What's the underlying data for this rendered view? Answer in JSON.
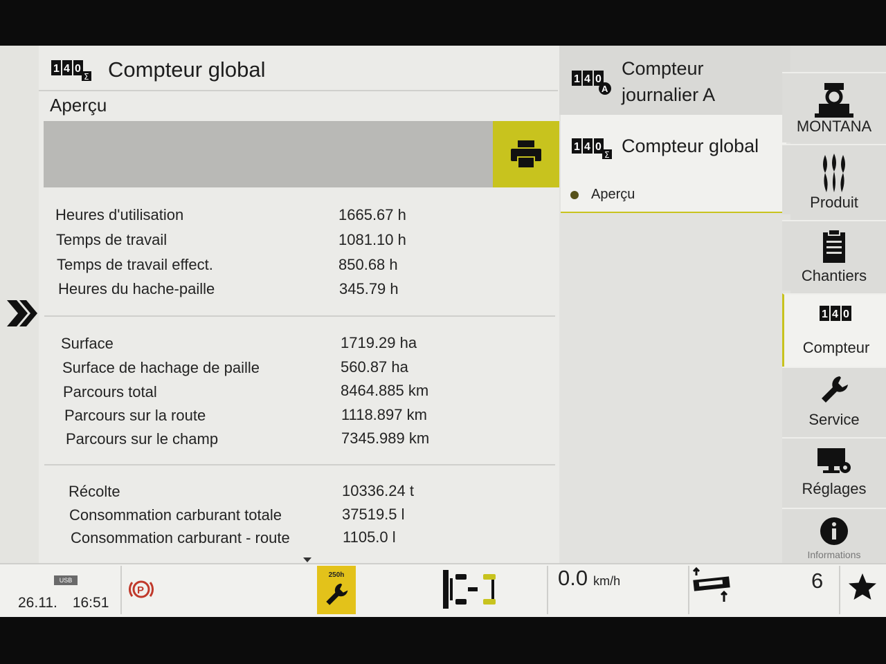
{
  "main": {
    "title": "Compteur global",
    "subtitle": "Aperçu",
    "groups": [
      {
        "rows": [
          {
            "label": "Heures d'utilisation",
            "value": "1665.67 h"
          },
          {
            "label": "Temps de travail",
            "value": "1081.10 h"
          },
          {
            "label": "Temps de travail effect.",
            "value": "850.68 h"
          },
          {
            "label": "Heures du hache-paille",
            "value": "345.79 h"
          }
        ]
      },
      {
        "rows": [
          {
            "label": "Surface",
            "value": "1719.29 ha"
          },
          {
            "label": "Surface de hachage de paille",
            "value": "560.87 ha"
          },
          {
            "label": "Parcours total",
            "value": "8464.885 km"
          },
          {
            "label": "Parcours sur la route",
            "value": "1118.897 km"
          },
          {
            "label": "Parcours sur le champ",
            "value": "7345.989 km"
          }
        ]
      },
      {
        "rows": [
          {
            "label": "Récolte",
            "value": "10336.24 t"
          },
          {
            "label": "Consommation carburant totale",
            "value": "37519.5 l"
          },
          {
            "label": "Consommation carburant - route",
            "value": "1105.0 l"
          }
        ]
      }
    ]
  },
  "nav": {
    "journalier_line1": "Compteur",
    "journalier_line2": "journalier A",
    "global_label": "Compteur global",
    "apercu_label": "Aperçu"
  },
  "sidebar": {
    "items": [
      {
        "label": "MONTANA",
        "icon": "operator-icon"
      },
      {
        "label": "Produit",
        "icon": "wheat-icon"
      },
      {
        "label": "Chantiers",
        "icon": "clipboard-icon"
      },
      {
        "label": "Compteur",
        "icon": "counter-icon"
      },
      {
        "label": "Service",
        "icon": "wrench-icon"
      },
      {
        "label": "Réglages",
        "icon": "monitor-gear-icon"
      },
      {
        "label": "Informations",
        "icon": "info-icon"
      }
    ]
  },
  "status": {
    "usb": "USB",
    "date": "26.11.",
    "time": "16:51",
    "service_hours": "250h",
    "speed_value": "0.0",
    "speed_unit": "km/h",
    "gear": "6"
  },
  "colors": {
    "accent": "#c8c31e",
    "warning": "#e3c21a",
    "parking": "#c0392b"
  }
}
